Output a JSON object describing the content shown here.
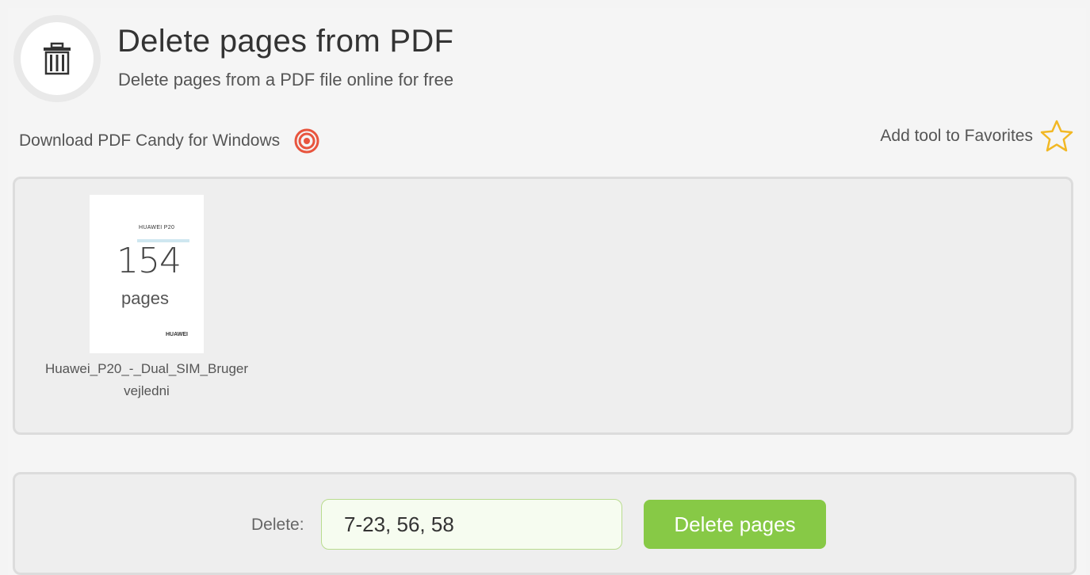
{
  "header": {
    "title": "Delete pages from PDF",
    "subtitle": "Delete pages from a PDF file online for free",
    "icon": "trash-icon"
  },
  "links": {
    "download": "Download PDF Candy for Windows",
    "download_icon": "candy-swirl-icon",
    "favorites": "Add tool to Favorites",
    "favorites_icon": "star-icon"
  },
  "file": {
    "thumb_brand_top": "HUAWEI P20",
    "page_count": "154",
    "pages_label": "pages",
    "thumb_brand_bottom": "HUAWEI",
    "name": "Huawei_P20_-_Dual_SIM_Brugervejledni"
  },
  "action": {
    "delete_label": "Delete:",
    "range_value": "7-23, 56, 58",
    "button_label": "Delete pages"
  },
  "colors": {
    "accent_green": "#87c946",
    "input_border": "#b9dc8f",
    "candy_red": "#e8553e",
    "star_yellow": "#f2b824"
  }
}
